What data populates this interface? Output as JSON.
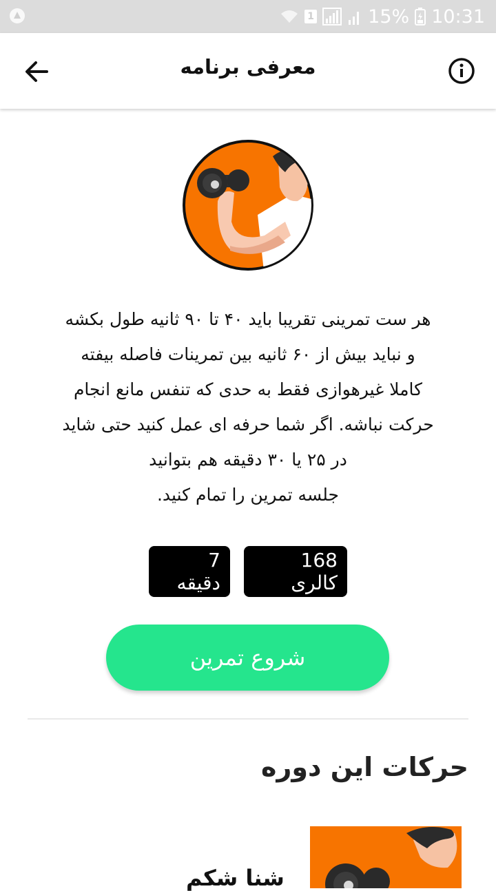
{
  "status_bar": {
    "battery_percent": "15%",
    "time": "10:31",
    "sim_slot": "1"
  },
  "header": {
    "title": "معرفی برنامه",
    "back_icon": "arrow-left-icon",
    "info_icon": "info-circle-icon"
  },
  "hero": {
    "icon": "dumbbell-curl-icon",
    "bg_color": "#f77400"
  },
  "description": {
    "lines": [
      "هر ست تمرینی تقریبا باید ۴۰ تا ۹۰ ثانیه طول بکشه",
      "و نباید بیش از ۶۰ ثانیه بین تمرینات فاصله بیفته",
      "کاملا غیرهوازی فقط به حدی که تنفس مانع انجام",
      "حرکت نباشه. اگر شما حرفه ای عمل کنید حتی شاید",
      "در ۲۵ یا ۳۰ دقیقه هم بتوانید",
      "جلسه تمرین را تمام کنید."
    ]
  },
  "stats": {
    "calories": "168 کالری",
    "duration": "7 دقیقه"
  },
  "start_button": {
    "label": "شروع تمرین",
    "color": "#25e58d"
  },
  "exercises_section": {
    "title": "حرکات این دوره",
    "items": [
      {
        "name": "شنا شکم"
      }
    ]
  }
}
